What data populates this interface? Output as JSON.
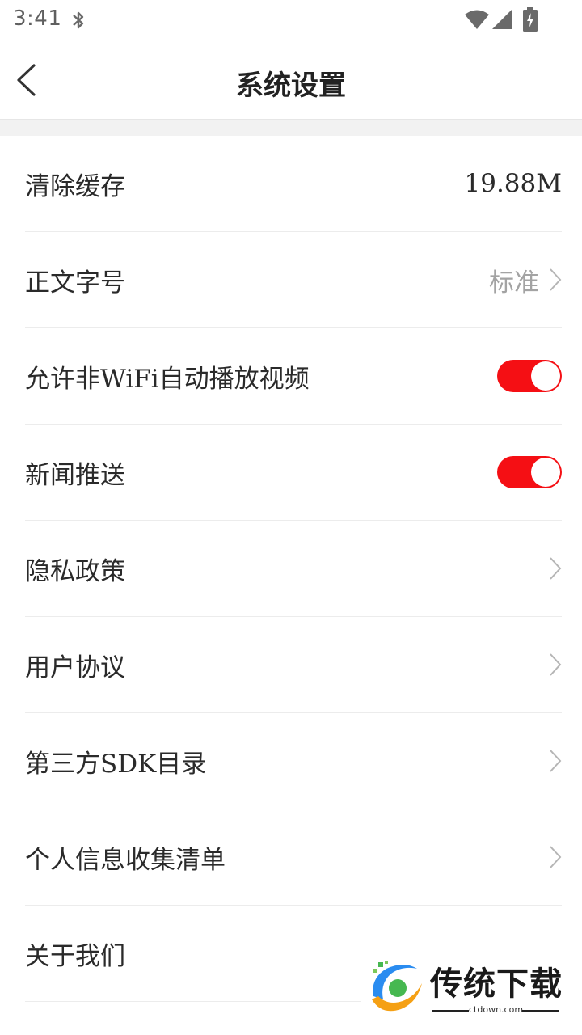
{
  "status_bar": {
    "time": "3:41",
    "icons": [
      "bluetooth-icon",
      "wifi-icon",
      "signal-icon",
      "battery-charging-icon"
    ]
  },
  "header": {
    "title": "系统设置",
    "back_icon": "chevron-left-icon"
  },
  "colors": {
    "accent": "#f50f14",
    "divider": "#ececec",
    "section_gap": "#f2f2f2",
    "muted_text": "#a3a3a3"
  },
  "settings": {
    "clear_cache": {
      "label": "清除缓存",
      "value": "19.88M"
    },
    "font_size": {
      "label": "正文字号",
      "value": "标准"
    },
    "autoplay_video": {
      "label": "允许非WiFi自动播放视频",
      "enabled": true
    },
    "news_push": {
      "label": "新闻推送",
      "enabled": true
    },
    "privacy_policy": {
      "label": "隐私政策"
    },
    "user_agreement": {
      "label": "用户协议"
    },
    "third_party_sdk": {
      "label": "第三方SDK目录"
    },
    "personal_info": {
      "label": "个人信息收集清单"
    },
    "about_us": {
      "label": "关于我们"
    }
  },
  "watermark": {
    "title": "传统下载",
    "domain": "ctdown.com"
  }
}
